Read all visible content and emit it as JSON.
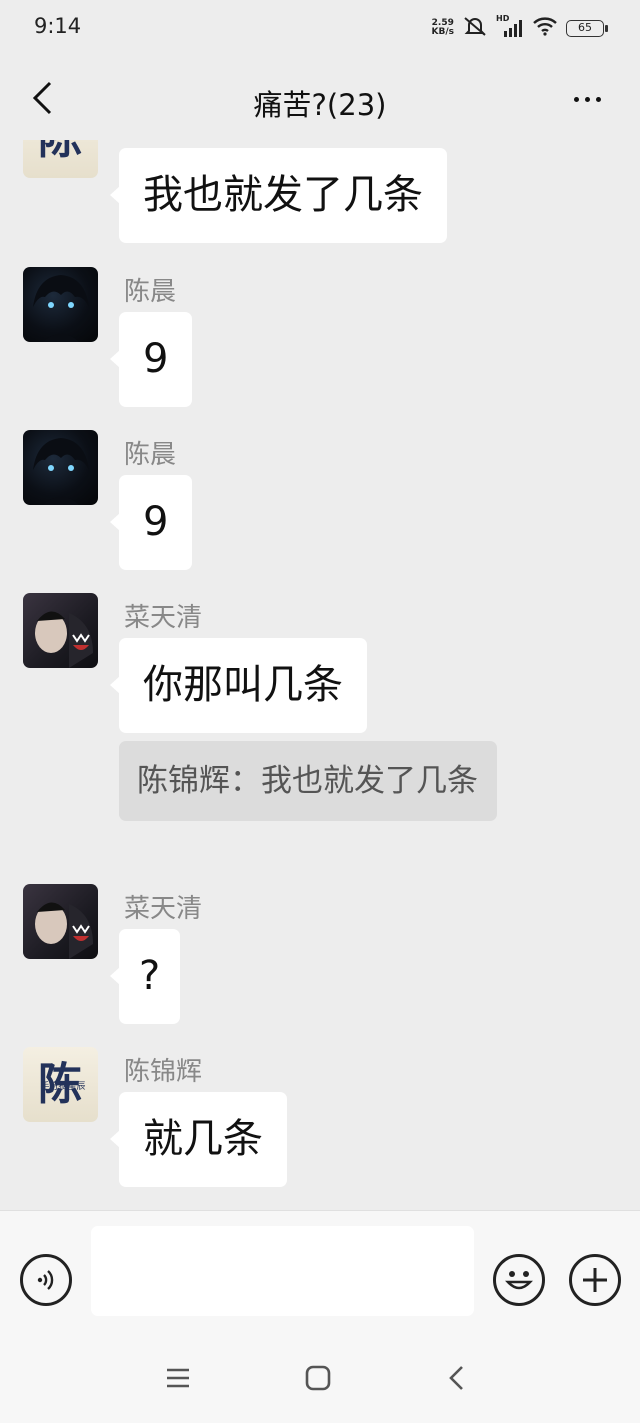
{
  "status_bar": {
    "time": "9:14",
    "net_speed_value": "2.59",
    "net_speed_unit": "KB/s",
    "signal_label": "HD",
    "battery": "65"
  },
  "header": {
    "title": "痛苦?(23)"
  },
  "messages": [
    {
      "sender": "",
      "text": "我也就发了几条",
      "avatar": "chen-logo-avatar"
    },
    {
      "sender": "陈晨",
      "text": "9",
      "avatar": "anime-boy-avatar"
    },
    {
      "sender": "陈晨",
      "text": "9",
      "avatar": "anime-boy-avatar"
    },
    {
      "sender": "菜天清",
      "text": "你那叫几条",
      "avatar": "shark-hoodie-avatar",
      "quote": "陈锦辉：我也就发了几条"
    },
    {
      "sender": "菜天清",
      "text": "?",
      "avatar": "shark-hoodie-avatar"
    },
    {
      "sender": "陈锦辉",
      "text": "就几条",
      "avatar": "chen-logo-avatar"
    }
  ],
  "avatar_logo": {
    "char": "陈",
    "subtext": "手可摘星辰"
  },
  "input": {
    "value": "",
    "placeholder": ""
  },
  "icons": {
    "back": "chevron-left-icon",
    "more": "more-dots-icon",
    "voice": "voice-icon",
    "emoji": "emoji-icon",
    "plus": "plus-icon",
    "nav_menu": "menu-icon",
    "nav_home": "home-icon",
    "nav_back": "back-icon"
  }
}
